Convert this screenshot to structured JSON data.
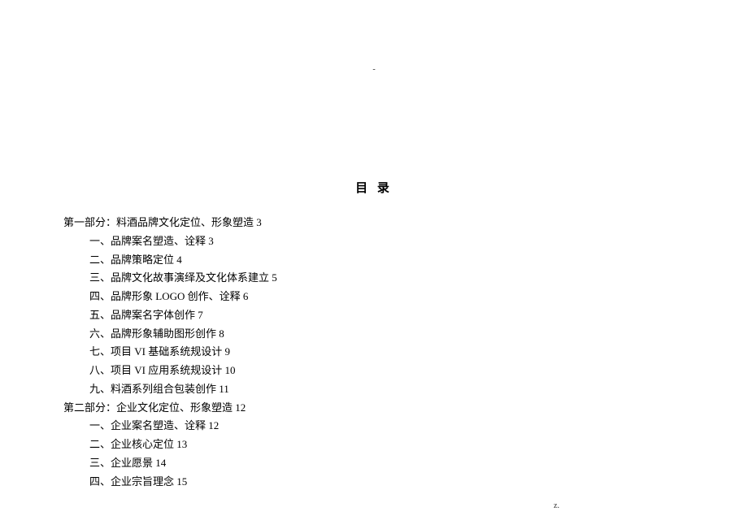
{
  "marks": {
    "top": "-",
    "bottom": "z."
  },
  "title": "目 录",
  "toc": [
    {
      "type": "section",
      "text": "第一部分：料酒品牌文化定位、形象塑造 3"
    },
    {
      "type": "item",
      "text": "一、品牌案名塑造、诠释 3"
    },
    {
      "type": "item",
      "text": "二、品牌策略定位 4"
    },
    {
      "type": "item",
      "text": "三、品牌文化故事演绎及文化体系建立 5"
    },
    {
      "type": "item",
      "text": "四、品牌形象 LOGO 创作、诠释 6"
    },
    {
      "type": "item",
      "text": "五、品牌案名字体创作 7"
    },
    {
      "type": "item",
      "text": "六、品牌形象辅助图形创作 8"
    },
    {
      "type": "item",
      "text": "七、项目 VI 基础系统规设计 9"
    },
    {
      "type": "item",
      "text": "八、项目 VI 应用系统规设计 10"
    },
    {
      "type": "item",
      "text": "九、料酒系列组合包装创作 11"
    },
    {
      "type": "section",
      "text": "第二部分：企业文化定位、形象塑造 12"
    },
    {
      "type": "item",
      "text": "一、企业案名塑造、诠释 12"
    },
    {
      "type": "item",
      "text": "二、企业核心定位 13"
    },
    {
      "type": "item",
      "text": "三、企业愿景 14"
    },
    {
      "type": "item",
      "text": "四、企业宗旨理念 15"
    }
  ]
}
